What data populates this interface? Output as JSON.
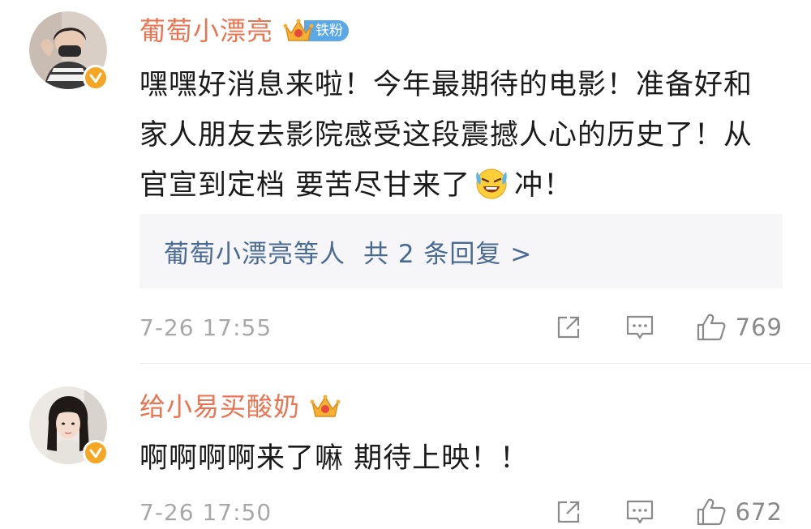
{
  "comments": [
    {
      "username": "葡萄小漂亮",
      "badge": {
        "label": "铁粉",
        "icon": "crown-icon"
      },
      "text_parts": [
        "嘿嘿好消息来啦！今年最期待的电影！准备好和家人朋友去影院感受这段震撼人心的历史了！从官宣到定档 要苦尽甘来了",
        "冲！"
      ],
      "emoji": "crying-laughing-emoji-icon",
      "replies": {
        "names": "葡萄小漂亮等人",
        "count_text": "共 2 条回复 >"
      },
      "timestamp": "7-26 17:55",
      "likes": "769"
    },
    {
      "username": "给小易买酸奶",
      "badge": {
        "icon": "crown-icon"
      },
      "text": "啊啊啊啊来了嘛 期待上映！！",
      "timestamp": "7-26 17:50",
      "likes": "672"
    }
  ],
  "colors": {
    "username": "#eb7350",
    "reply_link": "#4a6a91",
    "meta": "#a8a8a8",
    "verified": "#f5a623",
    "fan_badge": "#5aa8e6"
  }
}
